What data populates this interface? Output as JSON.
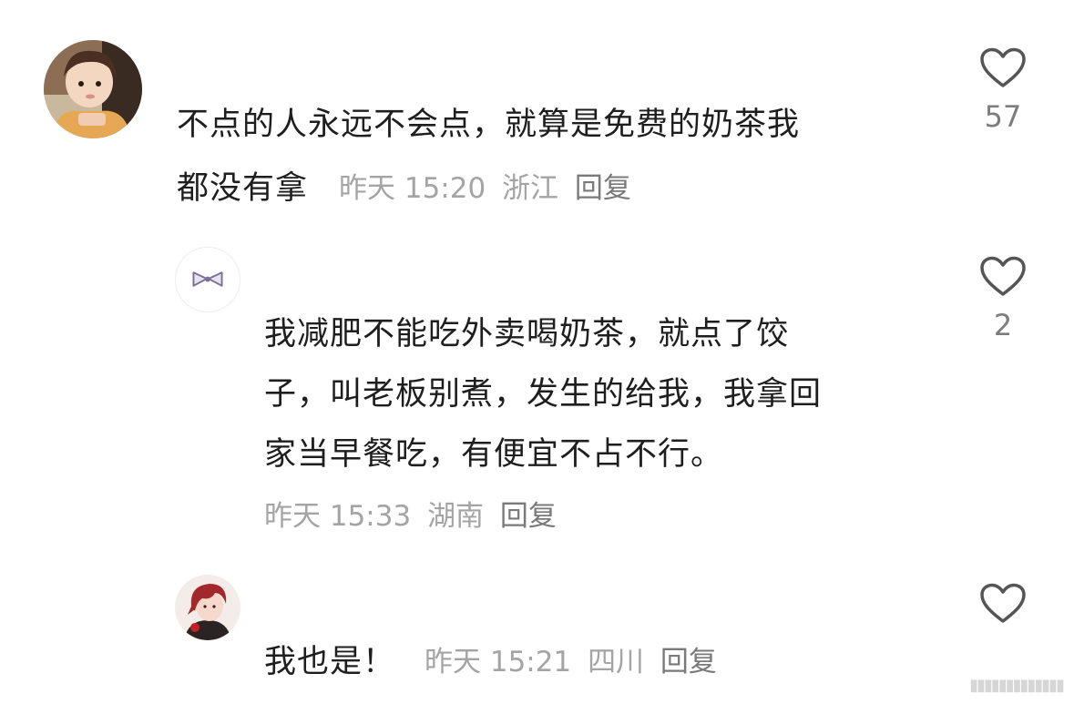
{
  "comments": [
    {
      "avatar": "girl-avatar",
      "lines": [
        "不点的人永远不会点，就算是免费的奶茶我",
        "都没有拿"
      ],
      "time": "昨天 15:20",
      "location": "浙江",
      "reply": "回复",
      "likes": "57"
    },
    {
      "avatar": "bow-avatar",
      "lines": [
        "我减肥不能吃外卖喝奶茶，就点了饺",
        "子，叫老板别煮，发生的给我，我拿回",
        "家当早餐吃，有便宜不占不行。"
      ],
      "time": "昨天 15:33",
      "location": "湖南",
      "reply": "回复",
      "likes": "2"
    },
    {
      "avatar": "anime-avatar",
      "lines": [
        "我也是！"
      ],
      "time": "昨天 15:21",
      "location": "四川",
      "reply": "回复",
      "likes": ""
    }
  ],
  "icons": {
    "like": "heart-outline-icon"
  },
  "colors": {
    "text": "#1e1e1e",
    "meta": "#a4a4a4",
    "heart": "#555555"
  }
}
